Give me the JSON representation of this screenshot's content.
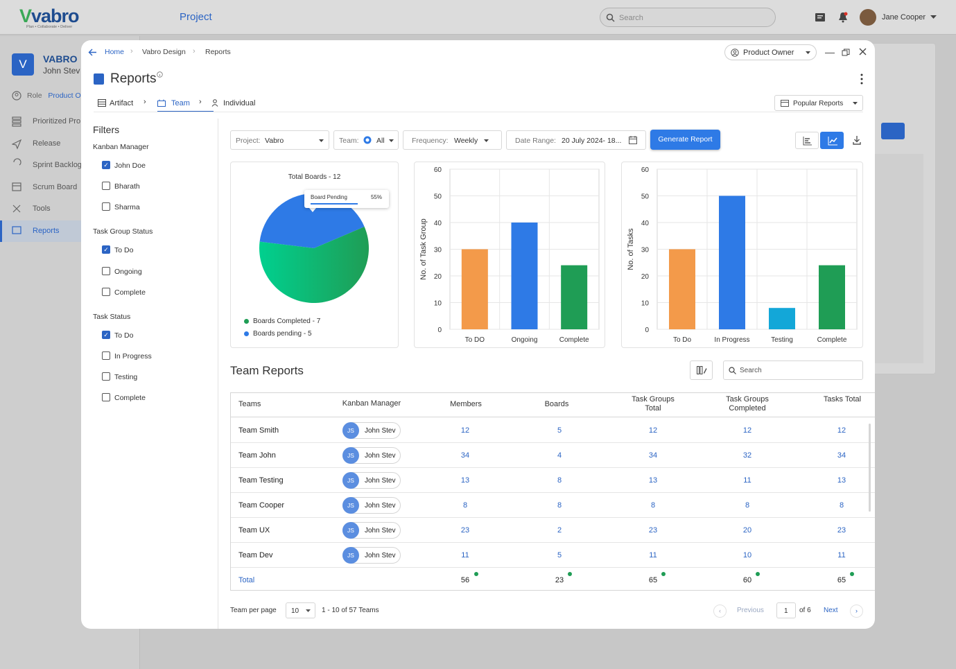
{
  "app": {
    "logo": "vabro",
    "tagline": "Plan • Collaborate • Deliver",
    "page_title": "Project",
    "search_placeholder": "Search",
    "user_name": "Jane Cooper"
  },
  "bg_sidebar": {
    "badge": "V",
    "org": "VABRO",
    "user": "John Stev",
    "role_label": "Role",
    "role_value": "Product O",
    "items": [
      "Prioritized Pro",
      "Release",
      "Sprint Backlog",
      "Scrum Board",
      "Tools",
      "Reports"
    ]
  },
  "breadcrumb": [
    "Home",
    "Vabro Design",
    "Reports"
  ],
  "role_select": "Product Owner",
  "page": {
    "title": "Reports"
  },
  "tabs": [
    "Artifact",
    "Team",
    "Individual"
  ],
  "popular_reports": "Popular Reports",
  "filters": {
    "title": "Filters",
    "groups": [
      {
        "name": "Kanban Manager",
        "options": [
          {
            "label": "John Doe",
            "checked": true
          },
          {
            "label": "Bharath",
            "checked": false
          },
          {
            "label": "Sharma",
            "checked": false
          }
        ]
      },
      {
        "name": "Task Group Status",
        "options": [
          {
            "label": "To Do",
            "checked": true
          },
          {
            "label": "Ongoing",
            "checked": false
          },
          {
            "label": "Complete",
            "checked": false
          }
        ]
      },
      {
        "name": "Task Status",
        "options": [
          {
            "label": "To Do",
            "checked": true
          },
          {
            "label": "In Progress",
            "checked": false
          },
          {
            "label": "Testing",
            "checked": false
          },
          {
            "label": "Complete",
            "checked": false
          }
        ]
      }
    ]
  },
  "controls": {
    "project_label": "Project:",
    "project_value": "Vabro",
    "team_label": "Team:",
    "team_value": "All",
    "frequency_label": "Frequency:",
    "frequency_value": "Weekly",
    "date_label": "Date Range:",
    "date_value": "20 July 2024- 18...",
    "generate": "Generate Report"
  },
  "chart_data": [
    {
      "type": "pie",
      "title": "Total Boards - 12",
      "slices": [
        {
          "label": "Boards Completed - 7",
          "value": 7,
          "color": "#1f9d55"
        },
        {
          "label": "Boards pending - 5",
          "value": 5,
          "color": "#2e7ae6"
        }
      ],
      "tooltip": {
        "label": "Board Pending",
        "value": "55%"
      }
    },
    {
      "type": "bar",
      "ylabel": "No. of Task Group",
      "ylim": [
        0,
        60
      ],
      "yticks": [
        0,
        10,
        20,
        30,
        40,
        50,
        60
      ],
      "categories": [
        "To DO",
        "Ongoing",
        "Complete"
      ],
      "values": [
        30,
        40,
        24
      ],
      "colors": [
        "#f39a4a",
        "#2e7ae6",
        "#1f9d55"
      ]
    },
    {
      "type": "bar",
      "ylabel": "No. of Tasks",
      "ylim": [
        0,
        60
      ],
      "yticks": [
        0,
        10,
        20,
        30,
        40,
        50,
        60
      ],
      "categories": [
        "To Do",
        "In Progress",
        "Testing",
        "Complete"
      ],
      "values": [
        30,
        50,
        8,
        24
      ],
      "colors": [
        "#f39a4a",
        "#2e7ae6",
        "#13a7d8",
        "#1f9d55"
      ]
    }
  ],
  "team_reports": {
    "title": "Team Reports",
    "search_placeholder": "Search",
    "headers": [
      "Teams",
      "Kanban Manager",
      "Members",
      "Boards",
      "Task Groups Total",
      "Task Groups Completed",
      "Tasks Total"
    ],
    "rows": [
      {
        "team": "Team Smith",
        "initials": "JS",
        "manager": "John Stev",
        "members": "12",
        "boards": "5",
        "tg_total": "12",
        "tg_completed": "12",
        "tasks_total": "12"
      },
      {
        "team": "Team John",
        "initials": "JS",
        "manager": "John Stev",
        "members": "34",
        "boards": "4",
        "tg_total": "34",
        "tg_completed": "32",
        "tasks_total": "34"
      },
      {
        "team": "Team Testing",
        "initials": "JS",
        "manager": "John Stev",
        "members": "13",
        "boards": "8",
        "tg_total": "13",
        "tg_completed": "11",
        "tasks_total": "13"
      },
      {
        "team": "Team Cooper",
        "initials": "JS",
        "manager": "John Stev",
        "members": "8",
        "boards": "8",
        "tg_total": "8",
        "tg_completed": "8",
        "tasks_total": "8"
      },
      {
        "team": "Team UX",
        "initials": "JS",
        "manager": "John Stev",
        "members": "23",
        "boards": "2",
        "tg_total": "23",
        "tg_completed": "20",
        "tasks_total": "23"
      },
      {
        "team": "Team Dev",
        "initials": "JS",
        "manager": "John Stev",
        "members": "11",
        "boards": "5",
        "tg_total": "11",
        "tg_completed": "10",
        "tasks_total": "11"
      }
    ],
    "total": {
      "label": "Total",
      "members": "56",
      "boards": "23",
      "tg_total": "65",
      "tg_completed": "60",
      "tasks_total": "65"
    }
  },
  "pagination": {
    "per_page_label": "Team per page",
    "per_page": "10",
    "range": "1 - 10 of 57 Teams",
    "previous": "Previous",
    "page": "1",
    "of": "of 6",
    "next": "Next"
  }
}
